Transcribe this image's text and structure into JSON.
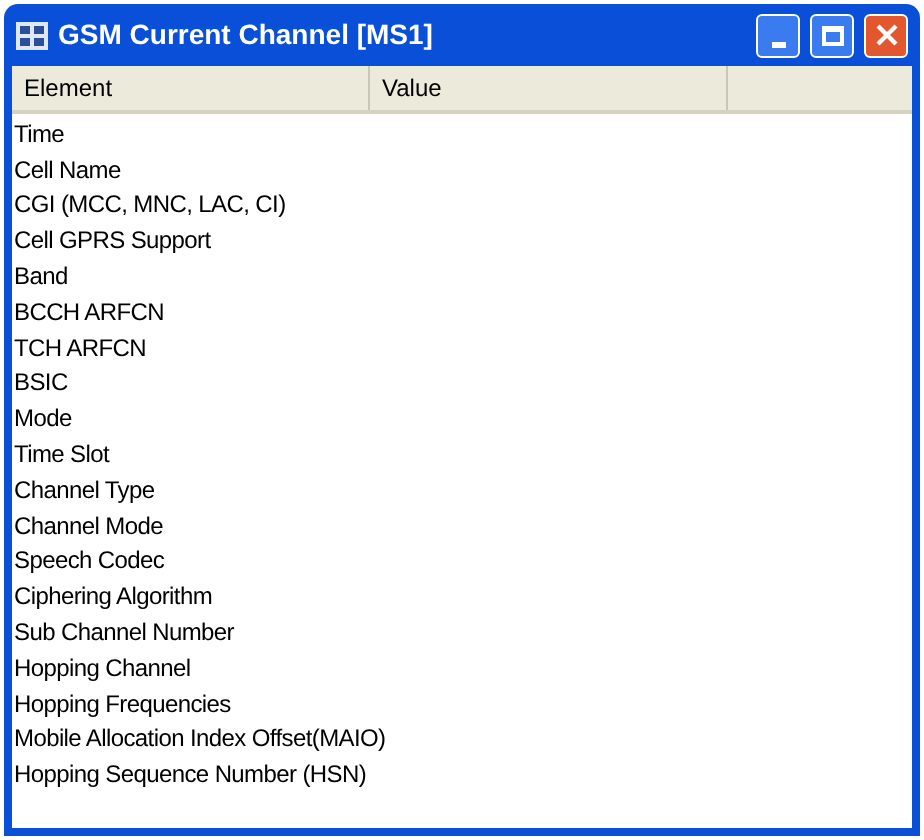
{
  "window": {
    "title": "GSM Current Channel [MS1]"
  },
  "table": {
    "columns": [
      "Element",
      "Value"
    ],
    "rows": [
      {
        "element": "Time"
      },
      {
        "element": "Cell Name"
      },
      {
        "element": "CGI (MCC, MNC, LAC, CI)"
      },
      {
        "element": "Cell GPRS Support"
      },
      {
        "element": "Band"
      },
      {
        "element": "BCCH ARFCN"
      },
      {
        "element": "TCH ARFCN"
      },
      {
        "element": "BSIC"
      },
      {
        "element": "Mode"
      },
      {
        "element": "Time Slot"
      },
      {
        "element": "Channel Type"
      },
      {
        "element": "Channel Mode"
      },
      {
        "element": "Speech Codec"
      },
      {
        "element": "Ciphering Algorithm"
      },
      {
        "element": "Sub Channel Number"
      },
      {
        "element": "Hopping Channel"
      },
      {
        "element": "Hopping Frequencies"
      },
      {
        "element": "Mobile Allocation Index Offset(MAIO)"
      },
      {
        "element": "Hopping Sequence Number (HSN)"
      }
    ]
  }
}
